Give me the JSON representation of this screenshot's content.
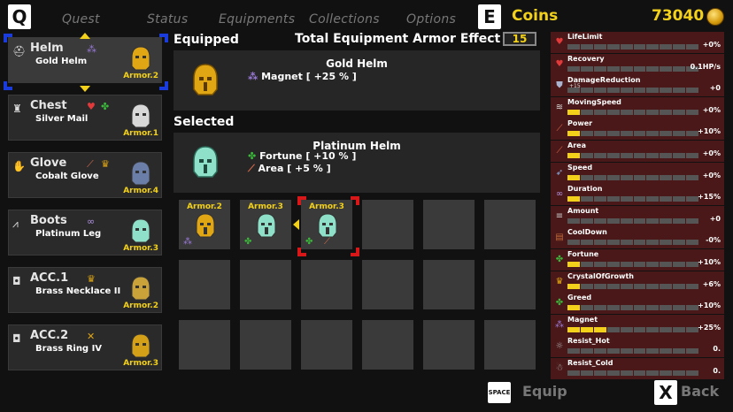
{
  "topbar": {
    "q_key": "Q",
    "e_key": "E",
    "tabs": [
      "Quest",
      "Status",
      "Equipments",
      "Collections",
      "Options"
    ],
    "coins_label": "Coins",
    "coins_value": "73040"
  },
  "slots": [
    {
      "type": "Helm",
      "name": "Gold Helm",
      "armor": "Armor.2",
      "stats": [
        "magnet"
      ],
      "icon": "helm-icon",
      "color": "#e0a614"
    },
    {
      "type": "Chest",
      "name": "Silver Mail",
      "armor": "Armor.1",
      "stats": [
        "recovery",
        "fortune"
      ],
      "icon": "chest-icon",
      "color": "#d8d8d8"
    },
    {
      "type": "Glove",
      "name": "Cobalt Glove",
      "armor": "Armor.4",
      "stats": [
        "power",
        "crystal"
      ],
      "icon": "glove-icon",
      "color": "#6b7ea8"
    },
    {
      "type": "Boots",
      "name": "Platinum Leg",
      "armor": "Armor.3",
      "stats": [
        "duration"
      ],
      "icon": "boots-icon",
      "color": "#8fe0c8"
    },
    {
      "type": "ACC.1",
      "name": "Brass Necklace II",
      "armor": "Armor.2",
      "stats": [
        "crystal"
      ],
      "icon": "necklace-icon",
      "color": "#c9a23a"
    },
    {
      "type": "ACC.2",
      "name": "Brass Ring IV",
      "armor": "Armor.3",
      "stats": [
        "area"
      ],
      "icon": "ring-icon",
      "color": "#d4a017"
    }
  ],
  "equipped": {
    "title": "Equipped",
    "name": "Gold Helm",
    "effects": [
      "Magnet [ +25 % ]"
    ]
  },
  "total": {
    "label": "Total Equipment Armor Effect",
    "value": "15"
  },
  "selected": {
    "title": "Selected",
    "name": "Platinum Helm",
    "effects": [
      "Fortune [ +10 % ]",
      "Area [ +5 % ]"
    ]
  },
  "grid": [
    {
      "armor": "Armor.2",
      "color": "#e0a614",
      "stat": "magnet"
    },
    {
      "armor": "Armor.3",
      "color": "#8fe0c8",
      "stat": "fortune"
    },
    {
      "armor": "Armor.3",
      "color": "#8fe0c8",
      "stat": "fortune-area",
      "selected": true
    }
  ],
  "stats": [
    {
      "name": "LifeLimit",
      "value": "+0%",
      "fill": 0,
      "icon": "heart-plus-icon",
      "color": "#e23a3a"
    },
    {
      "name": "Recovery",
      "value": "0.1HP/s",
      "fill": 0,
      "icon": "heart-icon",
      "color": "#e23a3a"
    },
    {
      "name": "DamageReduction",
      "value": "+0",
      "fill": 0,
      "sub": "+15",
      "icon": "shield-icon",
      "color": "#aab4d0"
    },
    {
      "name": "MovingSpeed",
      "value": "+0%",
      "fill": 1,
      "icon": "wing-icon",
      "color": "#dddddd"
    },
    {
      "name": "Power",
      "value": "+10%",
      "fill": 1,
      "icon": "sword-icon",
      "color": "#d86a4a"
    },
    {
      "name": "Area",
      "value": "+0%",
      "fill": 1,
      "icon": "wand-icon",
      "color": "#d86a4a"
    },
    {
      "name": "Speed",
      "value": "+0%",
      "fill": 1,
      "icon": "speed-icon",
      "color": "#8ab0e8"
    },
    {
      "name": "Duration",
      "value": "+15%",
      "fill": 1,
      "icon": "infinity-icon",
      "color": "#b090e0"
    },
    {
      "name": "Amount",
      "value": "+0",
      "fill": 0,
      "icon": "amount-icon",
      "color": "#cccccc"
    },
    {
      "name": "CoolDown",
      "value": "-0%",
      "fill": 0,
      "icon": "book-icon",
      "color": "#c06a3a"
    },
    {
      "name": "Fortune",
      "value": "+10%",
      "fill": 1,
      "icon": "clover-icon",
      "color": "#3ab83a"
    },
    {
      "name": "CrystalOfGrowth",
      "value": "+6%",
      "fill": 1,
      "icon": "crown-icon",
      "color": "#e0a614"
    },
    {
      "name": "Greed",
      "value": "+10%",
      "fill": 1,
      "icon": "greed-icon",
      "color": "#3ab83a"
    },
    {
      "name": "Magnet",
      "value": "+25%",
      "fill": 3,
      "icon": "magnet-icon",
      "color": "#9a7ad8"
    },
    {
      "name": "Resist_Hot",
      "value": "0.",
      "fill": 0,
      "icon": "hot-icon",
      "color": "#aaaaaa"
    },
    {
      "name": "Resist_Cold",
      "value": "0.",
      "fill": 0,
      "icon": "cold-icon",
      "color": "#aaaaaa"
    }
  ],
  "hints": {
    "space_key": "SPACE",
    "equip_label": "Equip",
    "x_key": "X",
    "back_label": "Back"
  },
  "colors": {
    "accent": "#f3d11a",
    "select_blue": "#1b3cdc",
    "select_red": "#d81818",
    "stat_bg": "#4a1818"
  }
}
